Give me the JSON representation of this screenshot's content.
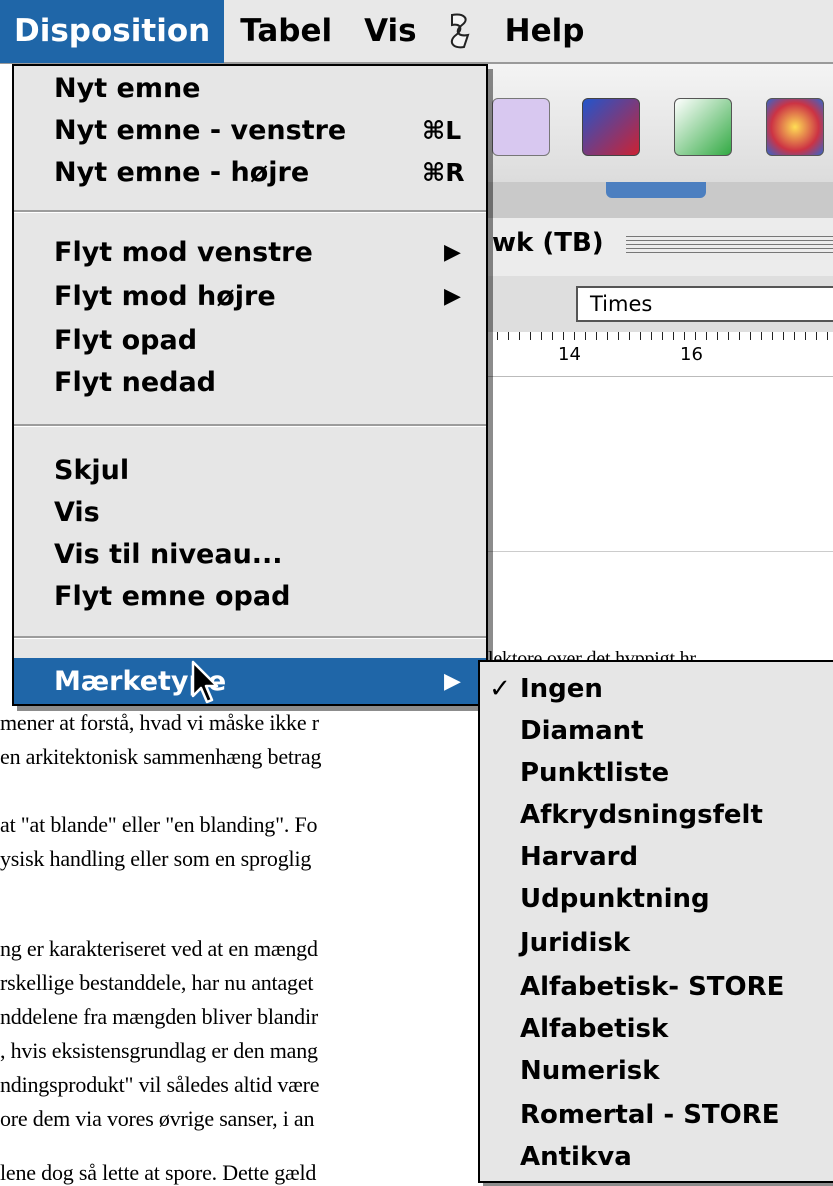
{
  "menubar": {
    "items": [
      {
        "label": "Disposition"
      },
      {
        "label": "Tabel"
      },
      {
        "label": "Vis"
      },
      {
        "label": "Help"
      }
    ],
    "script_icon": "script-menu-icon"
  },
  "background_window": {
    "title": "wk (TB)",
    "font_value": "Times",
    "ruler": [
      "14",
      "16"
    ]
  },
  "menu": {
    "groups": [
      [
        {
          "label": "Nyt emne",
          "shortcut": ""
        },
        {
          "label": "Nyt emne - venstre",
          "shortcut": "⌘L"
        },
        {
          "label": "Nyt emne - højre",
          "shortcut": "⌘R"
        }
      ],
      [
        {
          "label": "Flyt mod venstre",
          "submenu": true
        },
        {
          "label": "Flyt mod højre",
          "submenu": true
        },
        {
          "label": "Flyt opad"
        },
        {
          "label": "Flyt nedad"
        }
      ],
      [
        {
          "label": "Skjul"
        },
        {
          "label": "Vis"
        },
        {
          "label": "Vis til niveau..."
        },
        {
          "label": "Flyt emne opad"
        }
      ]
    ],
    "highlighted": {
      "label": "Mærketype",
      "submenu": true
    }
  },
  "submenu": {
    "items": [
      {
        "label": "Ingen",
        "checked": true
      },
      {
        "label": "Diamant"
      },
      {
        "label": "Punktliste"
      },
      {
        "label": "Afkrydsningsfelt"
      },
      {
        "label": "Harvard"
      },
      {
        "label": "Udpunktning"
      },
      {
        "label": "Juridisk"
      },
      {
        "label": "Alfabetisk- STORE"
      },
      {
        "label": "Alfabetisk"
      },
      {
        "label": "Numerisk"
      },
      {
        "label": "Romertal - STORE"
      },
      {
        "label": "Antikva"
      }
    ],
    "check_mark": "✓"
  },
  "document": {
    "lines": [
      "mener at forstå, hvad vi måske ikke r",
      "en arkitektonisk sammenhæng betrag",
      "at \"at blande\" eller \"en blanding\". Fo",
      "ysisk handling eller som en sproglig",
      "ng er karakteriseret ved at en mængd",
      "rskellige bestanddele, har nu antaget",
      "nddelene fra mængden bliver blandir",
      ", hvis eksistensgrundlag er den mang",
      "ndingsprodukt\" vil således altid være",
      "ore dem via vores øvrige sanser, i an",
      "lene dog så lette at spore. Dette gæld"
    ],
    "partial_top_line": "lektore over det hvppigt hr"
  },
  "colors": {
    "highlight": "#1f66a8",
    "menu_bg": "#e6e6e6"
  }
}
